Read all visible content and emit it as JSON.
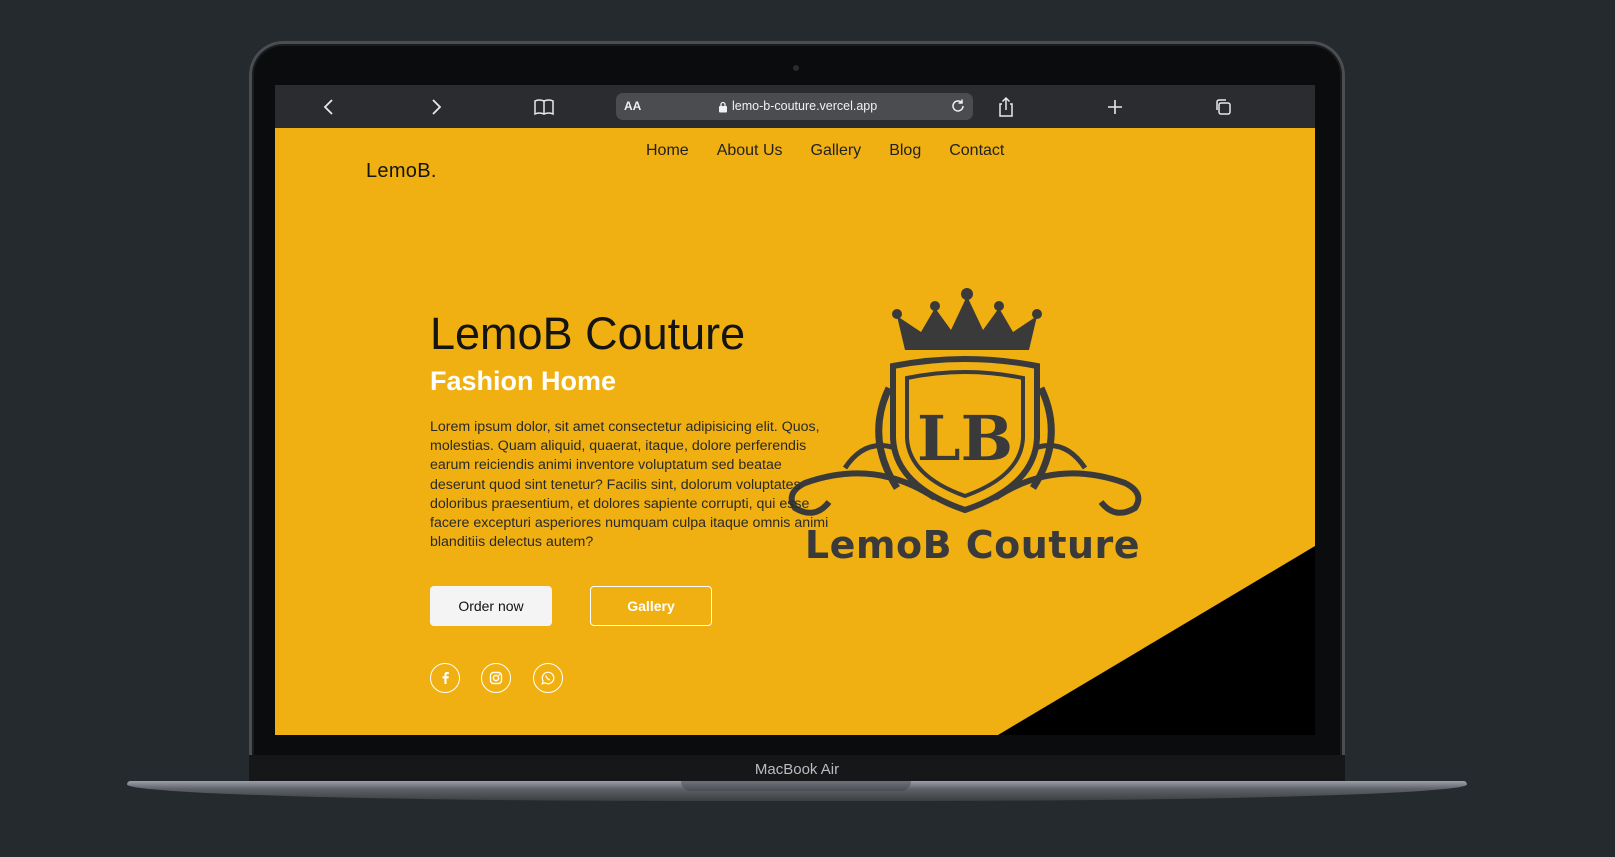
{
  "device": {
    "label": "MacBook Air"
  },
  "browser": {
    "text_size_label": "AA",
    "url": "lemo-b-couture.vercel.app",
    "icons": [
      "chevron-left-icon",
      "chevron-right-icon",
      "book-icon",
      "lock-icon",
      "reload-icon",
      "share-icon",
      "plus-icon",
      "tabs-icon"
    ]
  },
  "site": {
    "logo": "LemoB.",
    "nav": [
      "Home",
      "About Us",
      "Gallery",
      "Blog",
      "Contact"
    ],
    "hero": {
      "title": "LemoB Couture",
      "subtitle": "Fashion Home",
      "body": "Lorem ipsum dolor, sit amet consectetur adipisicing elit. Quos, molestias. Quam aliquid, quaerat, itaque, dolore perferendis earum reiciendis animi inventore voluptatum sed beatae deserunt quod sint tenetur? Facilis sint, dolorum voluptates doloribus praesentium, et dolores sapiente corrupti, qui esse facere excepturi asperiores numquam culpa itaque omnis animi blanditiis delectus autem?",
      "order_label": "Order now",
      "gallery_label": "Gallery"
    },
    "social_icons": [
      "facebook-icon",
      "instagram-icon",
      "whatsapp-icon"
    ],
    "crest": {
      "monogram": "LB",
      "wordmark": "LemoB Couture"
    },
    "colors": {
      "brand": "#f0b011",
      "dark": "#3a3a3a",
      "accent_black": "#000000"
    }
  }
}
